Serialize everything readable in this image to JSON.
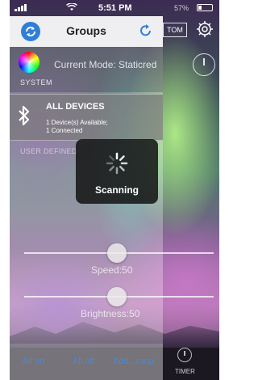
{
  "status_bar": {
    "time": "5:51 PM",
    "battery_text": "57%"
  },
  "background_screen": {
    "custom_button_label": "TOM",
    "timer_label": "TIMER"
  },
  "drawer": {
    "title": "Groups",
    "current_mode": "Current Mode: Staticred",
    "system_label": "SYSTEM",
    "all_devices": {
      "name": "ALL DEVICES",
      "available": "1 Device(s) Available;",
      "connected": "1 Connected"
    },
    "user_defined_label": "USER DEFINED",
    "speed": {
      "label": "Speed:50",
      "value": 50
    },
    "brightness": {
      "label": "Brightness:50",
      "value": 50
    },
    "actions": {
      "all_on": "All on",
      "all_off": "All off",
      "add_group": "Add...roup"
    }
  },
  "hud": {
    "label": "Scanning"
  },
  "colors": {
    "accent": "#2f7fd8",
    "action_text": "#3a8ee8"
  }
}
